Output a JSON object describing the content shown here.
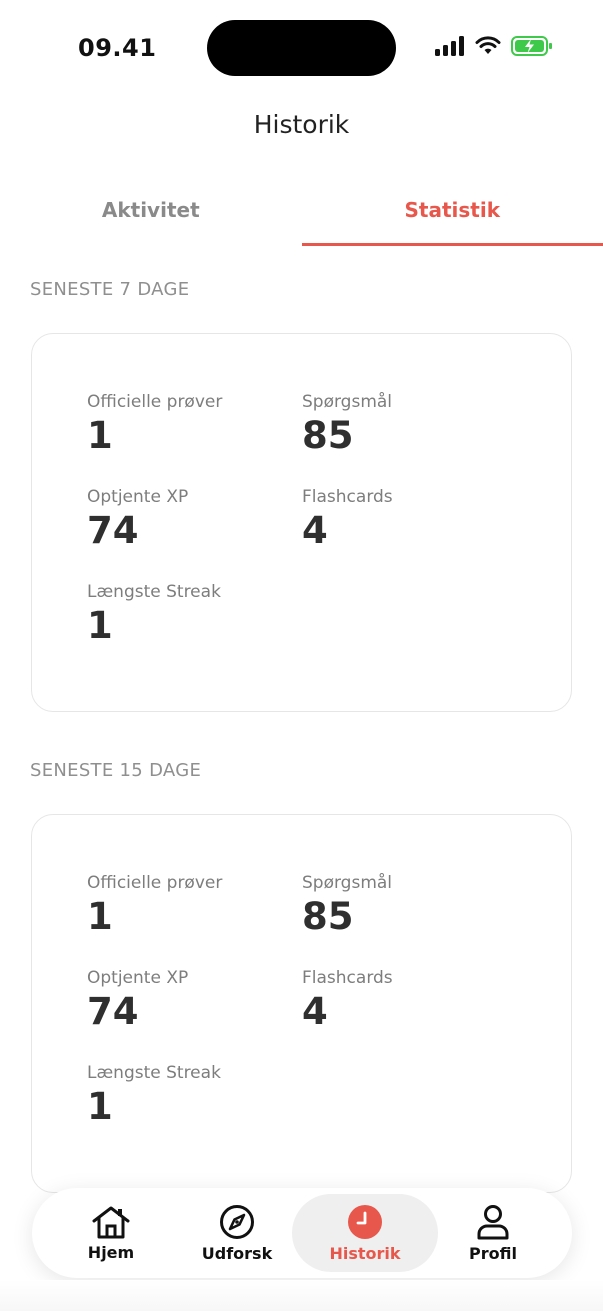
{
  "status_bar": {
    "time": "09.41",
    "icons": [
      "signal-icon",
      "wifi-icon",
      "battery-charging-icon"
    ],
    "battery_color": "#3fc94a"
  },
  "header": {
    "title": "Historik"
  },
  "tabs": [
    {
      "label": "Aktivitet",
      "active": false
    },
    {
      "label": "Statistik",
      "active": true
    }
  ],
  "accent_color": "#e8574b",
  "sections": [
    {
      "title": "SENESTE 7 DAGE",
      "stats": {
        "official_tests": {
          "label": "Officielle prøver",
          "value": "1"
        },
        "questions": {
          "label": "Spørgsmål",
          "value": "85"
        },
        "earned_xp": {
          "label": "Optjente XP",
          "value": "74"
        },
        "flashcards": {
          "label": "Flashcards",
          "value": "4"
        },
        "longest_streak": {
          "label": "Længste Streak",
          "value": "1"
        }
      }
    },
    {
      "title": "SENESTE 15 DAGE",
      "stats": {
        "official_tests": {
          "label": "Officielle prøver",
          "value": "1"
        },
        "questions": {
          "label": "Spørgsmål",
          "value": "85"
        },
        "earned_xp": {
          "label": "Optjente XP",
          "value": "74"
        },
        "flashcards": {
          "label": "Flashcards",
          "value": "4"
        },
        "longest_streak": {
          "label": "Længste Streak",
          "value": "1"
        }
      }
    }
  ],
  "bottom_nav": [
    {
      "label": "Hjem",
      "icon": "home-icon",
      "active": false
    },
    {
      "label": "Udforsk",
      "icon": "compass-icon",
      "active": false
    },
    {
      "label": "Historik",
      "icon": "clock-icon",
      "active": true
    },
    {
      "label": "Profil",
      "icon": "user-icon",
      "active": false
    }
  ]
}
